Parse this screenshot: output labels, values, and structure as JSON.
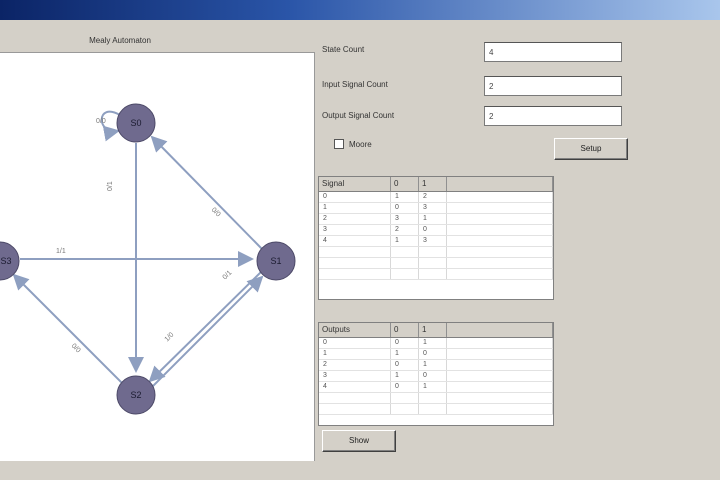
{
  "window": {
    "title": ""
  },
  "canvas": {
    "caption": "Mealy Automaton"
  },
  "graph": {
    "nodes": [
      {
        "id": "S0",
        "label": "S0"
      },
      {
        "id": "S1",
        "label": "S1"
      },
      {
        "id": "S2",
        "label": "S2"
      },
      {
        "id": "S3",
        "label": "S3"
      }
    ],
    "edge_labels": {
      "self_s0": "0/0",
      "s0_s2": "0/1",
      "s1_s0": "0/0",
      "s2_s1": "1/1",
      "s1_s3": "0/1",
      "s3_s1": "1/0",
      "s3_s2": "0/0"
    }
  },
  "form": {
    "state_count": {
      "label": "State Count",
      "value": "4"
    },
    "input_count": {
      "label": "Input Signal Count",
      "value": "2"
    },
    "output_count": {
      "label": "Output Signal Count",
      "value": "2"
    },
    "moore": {
      "label": "Moore",
      "checked": false
    },
    "setup_button": "Setup"
  },
  "signals_table": {
    "headers": [
      "Signal",
      "0",
      "1"
    ],
    "rows": [
      [
        "0",
        "1",
        "2"
      ],
      [
        "1",
        "0",
        "3"
      ],
      [
        "2",
        "3",
        "1"
      ],
      [
        "3",
        "2",
        "0"
      ],
      [
        "4",
        "1",
        "3"
      ]
    ]
  },
  "outputs_table": {
    "headers": [
      "Outputs",
      "0",
      "1"
    ],
    "rows": [
      [
        "0",
        "0",
        "1"
      ],
      [
        "1",
        "1",
        "0"
      ],
      [
        "2",
        "0",
        "1"
      ],
      [
        "3",
        "1",
        "0"
      ],
      [
        "4",
        "0",
        "1"
      ]
    ]
  },
  "show_button": "Show"
}
